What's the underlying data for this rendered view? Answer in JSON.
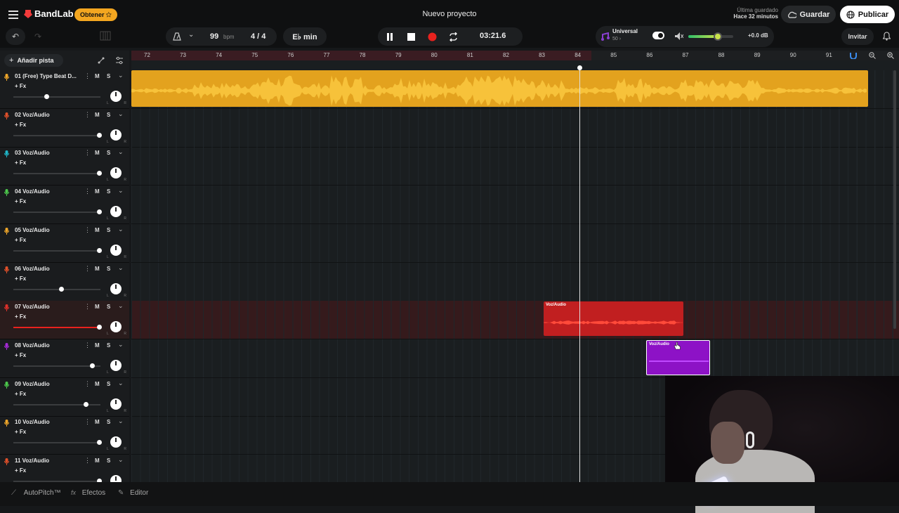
{
  "brand": {
    "name": "BandLab",
    "obtain_label": "Obtener ✩"
  },
  "project_title": "Nuevo proyecto",
  "save_status": {
    "line1": "Última guardado",
    "line2": "Hace 32 minutos"
  },
  "buttons": {
    "save": "Guardar",
    "publish": "Publicar",
    "invite": "Invitar",
    "add_track": "Añadir pista"
  },
  "transport": {
    "bpm": "99",
    "bpm_unit": "bpm",
    "time_signature": "4 / 4",
    "key": "E♭ min",
    "time": "03:21.6"
  },
  "master": {
    "preset_name": "Universal",
    "preset_sub": "50 ›",
    "volume_db": "+0.0 dB",
    "volume_level": 0.65
  },
  "ruler_ticks": [
    "72",
    "73",
    "74",
    "75",
    "76",
    "77",
    "78",
    "79",
    "80",
    "81",
    "82",
    "83",
    "84",
    "85",
    "86",
    "87",
    "88",
    "89",
    "90",
    "91"
  ],
  "tracks": [
    {
      "name": "01  (Free) Type Beat D...",
      "fx": "+ Fx",
      "mic_color": "#f0a72a",
      "volume": 0.38
    },
    {
      "name": "02  Voz/Audio",
      "fx": "+ Fx",
      "mic_color": "#e0502a",
      "volume": 0.98
    },
    {
      "name": "03  Voz/Audio",
      "fx": "+ Fx",
      "mic_color": "#1fb5c7",
      "volume": 0.98
    },
    {
      "name": "04  Voz/Audio",
      "fx": "+ Fx",
      "mic_color": "#4cc94c",
      "volume": 0.98
    },
    {
      "name": "05  Voz/Audio",
      "fx": "+ Fx",
      "mic_color": "#f0a72a",
      "volume": 0.98
    },
    {
      "name": "06  Voz/Audio",
      "fx": "+ Fx",
      "mic_color": "#e0502a",
      "volume": 0.55
    },
    {
      "name": "07  Voz/Audio",
      "fx": "+ Fx",
      "mic_color": "#e0302a",
      "volume": 0.98
    },
    {
      "name": "08  Voz/Audio",
      "fx": "+ Fx",
      "mic_color": "#a52ad6",
      "volume": 0.9
    },
    {
      "name": "09  Voz/Audio",
      "fx": "+ Fx",
      "mic_color": "#4cc94c",
      "volume": 0.83
    },
    {
      "name": "10  Voz/Audio",
      "fx": "+ Fx",
      "mic_color": "#f0a72a",
      "volume": 0.98
    },
    {
      "name": "11  Voz/Audio",
      "fx": "+ Fx",
      "mic_color": "#e0502a",
      "volume": 0.98
    }
  ],
  "track_controls": {
    "mute": "M",
    "solo": "S",
    "pan_l": "L",
    "pan_r": "R"
  },
  "clips": {
    "vocal_red": "Voz/Audio",
    "vocal_purple": "Voz/Audio"
  },
  "bottom": {
    "autopitch": "AutoPitch™",
    "effects": "Efectos",
    "editor": "Editor"
  },
  "colors": {
    "accent_orange": "#f3a620",
    "beat_clip": "#e8a820",
    "red_clip": "#c0201e",
    "purple_clip": "#8e12c8",
    "brand_red": "#f23a3a"
  }
}
